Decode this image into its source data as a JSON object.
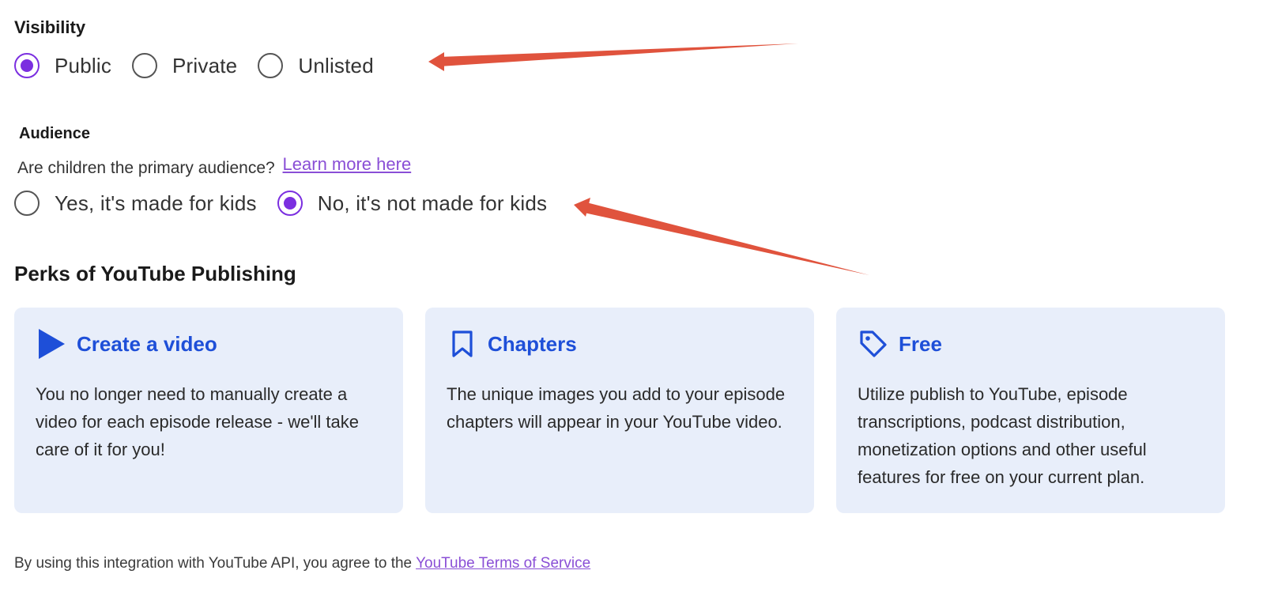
{
  "visibility": {
    "title": "Visibility",
    "options": [
      "Public",
      "Private",
      "Unlisted"
    ],
    "selected": "Public"
  },
  "audience": {
    "title": "Audience",
    "question": "Are children the primary audience?",
    "link_text": "Learn more here",
    "options": [
      "Yes, it's made for kids",
      "No, it's not made for kids"
    ],
    "selected": "No, it's not made for kids"
  },
  "perks": {
    "title": "Perks of YouTube Publishing",
    "cards": [
      {
        "icon": "play-icon",
        "title": "Create a video",
        "text": "You no longer need to manually create a video for each episode release - we'll take care of it for you!"
      },
      {
        "icon": "bookmark-icon",
        "title": "Chapters",
        "text": "The unique images you add to your episode chapters will appear in your YouTube video."
      },
      {
        "icon": "tag-icon",
        "title": "Free",
        "text": "Utilize publish to YouTube, episode transcriptions, podcast distribution, monetization options and other useful features for free on your current plan."
      }
    ]
  },
  "footer": {
    "text": "By using this integration with YouTube API, you agree to the",
    "link_text": "YouTube Terms of Service"
  },
  "colors": {
    "accent": "#7b2fe0",
    "link": "#8a4fd6",
    "card_bg": "#e8eefa",
    "card_title": "#1e4fd8",
    "annotation_arrow": "#e0533d"
  }
}
